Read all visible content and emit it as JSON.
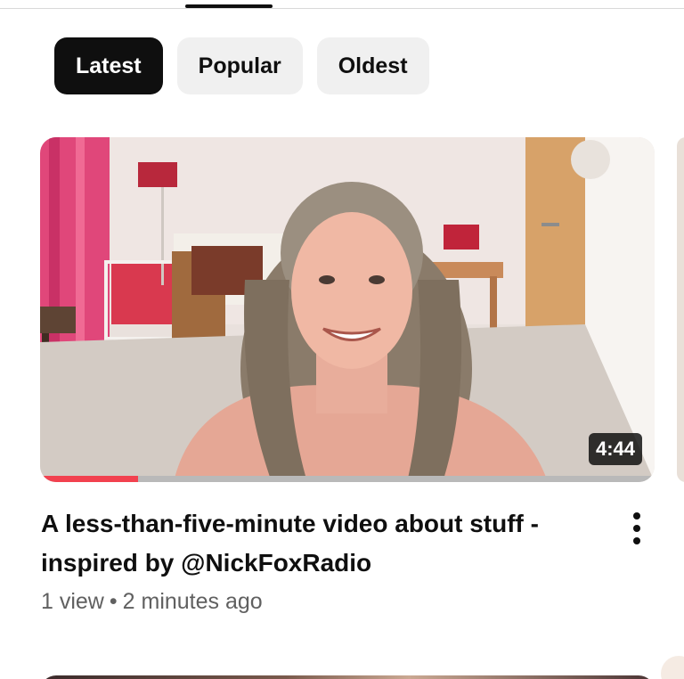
{
  "filters": {
    "chips": [
      {
        "label": "Latest",
        "active": true
      },
      {
        "label": "Popular",
        "active": false
      },
      {
        "label": "Oldest",
        "active": false
      }
    ]
  },
  "video": {
    "duration": "4:44",
    "watch_progress_percent": 16,
    "title_line1": "A less-than-five-minute video about stuff -",
    "title_line2": "inspired by @NickFoxRadio",
    "views": "1 view",
    "separator": "•",
    "age": "2 minutes ago"
  },
  "colors": {
    "chip_active_bg": "#0f0f0f",
    "chip_bg": "#f0f0f0",
    "progress_red": "#f2414f",
    "meta_gray": "#606060"
  }
}
